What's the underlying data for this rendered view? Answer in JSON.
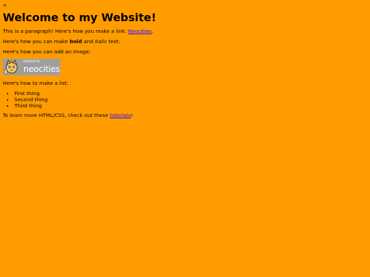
{
  "stray_text": ">",
  "heading": "Welcome to my Website!",
  "para1": {
    "before": "This is a paragraph! Here's how you make a link: ",
    "link": "Neocities",
    "after": "."
  },
  "para2": {
    "before": "Here's how you can make ",
    "bold": "bold",
    "middle": " and ",
    "italic": "italic",
    "after": " text."
  },
  "para3": "Here's how you can add an image:",
  "badge": {
    "hosted_by": "hosted by",
    "brand": "neocities",
    "icon": "neocities-cat-icon",
    "color": "#9e9e9e"
  },
  "list_intro": "Here's how to make a list:",
  "list_items": [
    "First thing",
    "Second thing",
    "Third thing"
  ],
  "outro": {
    "before": "To learn more HTML/CSS, check out these ",
    "link": "tutorials",
    "after": "!"
  },
  "colors": {
    "background": "#ff9c00",
    "link": "#2b00ff"
  }
}
